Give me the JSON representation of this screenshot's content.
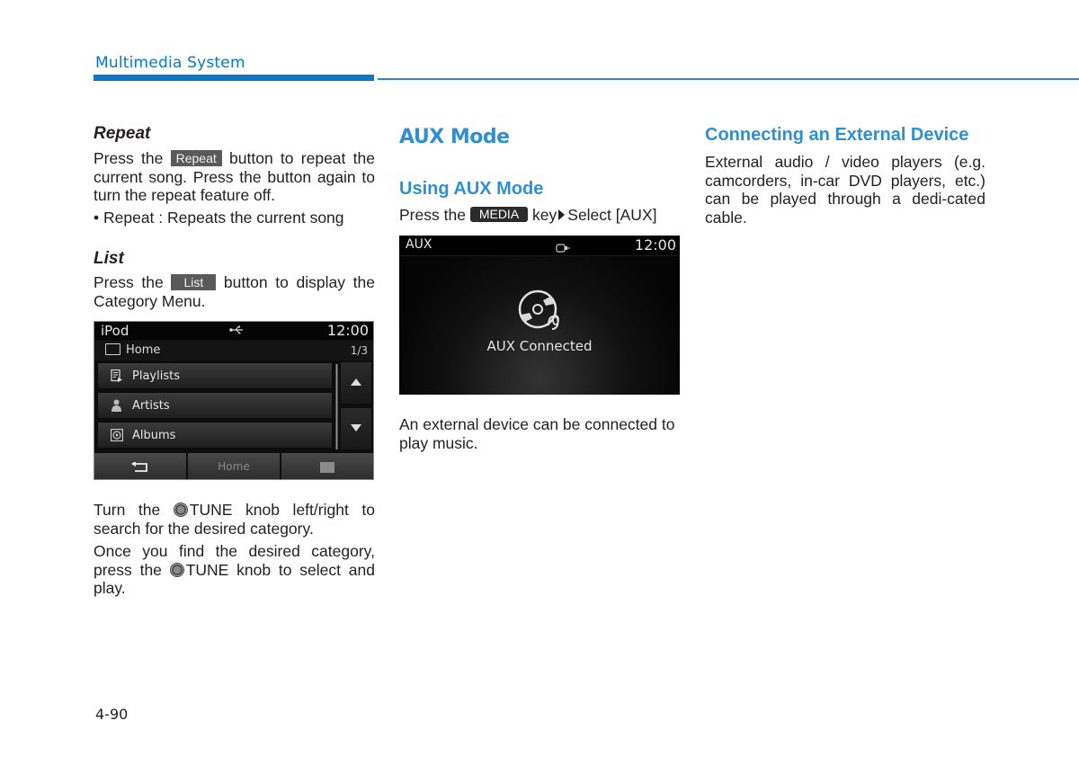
{
  "header": {
    "section_title": "Multimedia System"
  },
  "left_column": {
    "repeat": {
      "heading": "Repeat",
      "p1_before": "Press the",
      "button_label": "Repeat",
      "p1_after": "button to repeat the current song. Press the button again to turn the repeat feature off.",
      "bullet": "• Repeat : Repeats the current song"
    },
    "list": {
      "heading": "List",
      "p1_before": "Press the",
      "button_label": "List",
      "p1_after": "button to display the Category Menu."
    },
    "tune": {
      "p1_before": "Turn the",
      "knob_label": "TUNE",
      "p1_after": "knob left/right to search for the desired category.",
      "p2_before": "Once you find the desired category, press the",
      "p2_knob": "TUNE",
      "p2_after": "knob to select and play."
    }
  },
  "ipod_screen": {
    "source": "iPod",
    "usb_icon": "usb-icon",
    "time": "12:00",
    "path": "Home",
    "page": "1/3",
    "items": [
      {
        "label": "Playlists",
        "icon": "playlist-icon"
      },
      {
        "label": "Artists",
        "icon": "artist-icon"
      },
      {
        "label": "Albums",
        "icon": "album-icon"
      }
    ],
    "bottom": {
      "back_icon": "back-icon",
      "home_label": "Home",
      "folder_up_icon": "folder-up-icon"
    }
  },
  "middle_column": {
    "title": "AUX Mode",
    "subheading": "Using AUX Mode",
    "p1_before": "Press the",
    "media_key": "MEDIA",
    "p1_key": "key",
    "p1_after": "Select [AUX]",
    "p2": "An external device can be connected to play music."
  },
  "aux_screen": {
    "source": "AUX",
    "time": "12:00",
    "status": "AUX Connected"
  },
  "right_column": {
    "heading": "Connecting an External Device",
    "p1": "External audio / video players (e.g. camcorders, in-car DVD players, etc.) can be played through a dedi-cated cable."
  },
  "footer": {
    "page_number": "4-90"
  },
  "colors": {
    "accent_blue": "#0a78c2",
    "heading_blue": "#2e90d0"
  }
}
